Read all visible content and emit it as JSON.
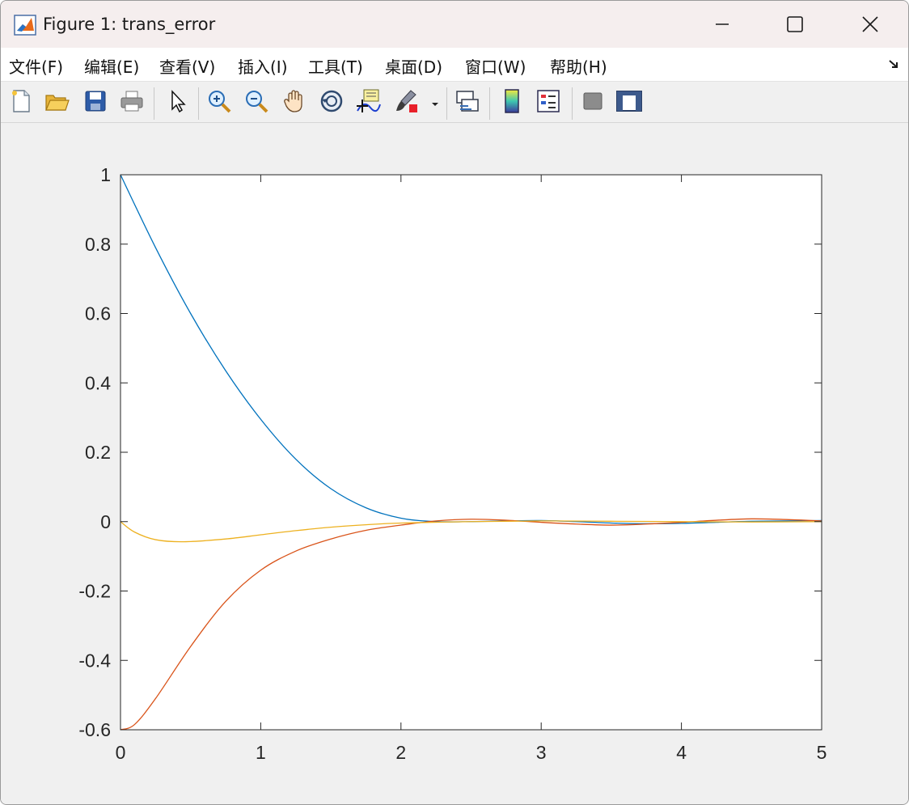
{
  "window": {
    "title": "Figure 1: trans_error",
    "app_icon": "matlab-logo-icon",
    "controls": [
      "minimize-icon",
      "maximize-icon",
      "close-icon"
    ]
  },
  "menu": {
    "items": [
      "文件(F)",
      "编辑(E)",
      "查看(V)",
      "插入(I)",
      "工具(T)",
      "桌面(D)",
      "窗口(W)",
      "帮助(H)"
    ],
    "dock_icon": "dock-arrow-icon"
  },
  "toolbar": {
    "buttons": [
      "new-figure-icon",
      "open-file-icon",
      "save-icon",
      "print-icon",
      "edit-plot-pointer-icon",
      "zoom-in-icon",
      "zoom-out-icon",
      "pan-hand-icon",
      "rotate-3d-icon",
      "data-cursor-icon",
      "brush-icon",
      "brush-dropdown-icon",
      "link-plot-icon",
      "colorbar-icon",
      "legend-icon",
      "hide-plot-tools-icon",
      "show-plot-tools-icon"
    ]
  },
  "chart_data": {
    "type": "line",
    "title": "",
    "xlabel": "",
    "ylabel": "",
    "xlim": [
      0,
      5
    ],
    "ylim": [
      -0.6,
      1
    ],
    "xticks": [
      "0",
      "1",
      "2",
      "3",
      "4",
      "5"
    ],
    "yticks": [
      "-0.6",
      "-0.4",
      "-0.2",
      "0",
      "0.2",
      "0.4",
      "0.6",
      "0.8",
      "1"
    ],
    "grid": false,
    "box": true,
    "series": [
      {
        "color": "#0072BD",
        "x": [
          0,
          0.25,
          0.5,
          0.75,
          1.0,
          1.25,
          1.5,
          1.75,
          2.0,
          2.25,
          2.5,
          2.75,
          3.0,
          3.25,
          3.5,
          3.75,
          4.0,
          4.25,
          4.5,
          4.75,
          5.0
        ],
        "y": [
          1.0,
          0.79,
          0.6,
          0.435,
          0.295,
          0.18,
          0.095,
          0.04,
          0.01,
          0.0,
          0.0,
          0.002,
          0.003,
          0.0,
          -0.004,
          -0.006,
          -0.005,
          -0.002,
          0.001,
          0.002,
          0.003
        ]
      },
      {
        "color": "#D95319",
        "x": [
          0,
          0.1,
          0.25,
          0.5,
          0.75,
          1.0,
          1.25,
          1.5,
          1.75,
          2.0,
          2.25,
          2.5,
          2.75,
          3.0,
          3.25,
          3.5,
          3.75,
          4.0,
          4.25,
          4.5,
          4.75,
          5.0
        ],
        "y": [
          -0.6,
          -0.585,
          -0.51,
          -0.36,
          -0.23,
          -0.14,
          -0.085,
          -0.05,
          -0.025,
          -0.01,
          0.002,
          0.007,
          0.004,
          -0.002,
          -0.007,
          -0.01,
          -0.007,
          -0.002,
          0.004,
          0.008,
          0.006,
          0.002
        ]
      },
      {
        "color": "#EDB120",
        "x": [
          0,
          0.1,
          0.25,
          0.45,
          0.75,
          1.0,
          1.25,
          1.5,
          1.75,
          2.0,
          2.5,
          3.0,
          3.5,
          4.0,
          4.5,
          5.0
        ],
        "y": [
          0.0,
          -0.03,
          -0.052,
          -0.058,
          -0.05,
          -0.038,
          -0.026,
          -0.016,
          -0.009,
          -0.004,
          0.0,
          0.002,
          0.001,
          0.0,
          -0.001,
          0.0
        ]
      }
    ]
  }
}
